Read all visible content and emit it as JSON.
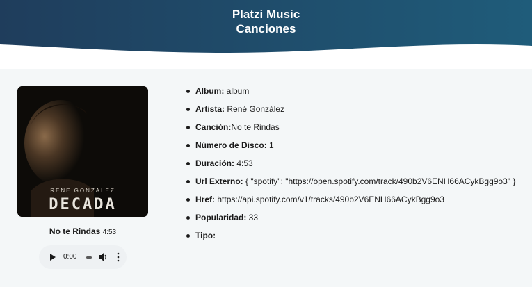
{
  "header": {
    "title_line1": "Platzi Music",
    "title_line2": "Canciones",
    "gradient_start": "#1f3d5c",
    "gradient_end": "#1f5c7a"
  },
  "song": {
    "name": "No te Rindas",
    "duration": "4:53",
    "cover_artist_text": "RENE GONZALEZ",
    "cover_album_text": "DECADA"
  },
  "player": {
    "current_time": "0:00",
    "play_icon": "play-icon",
    "volume_icon": "volume-icon",
    "menu_icon": "more-vert-icon"
  },
  "details": [
    {
      "label": "Album:",
      "value": " album"
    },
    {
      "label": "Artista:",
      "value": " René González"
    },
    {
      "label": "Canción:",
      "value": "No te Rindas"
    },
    {
      "label": "Número de Disco:",
      "value": " 1"
    },
    {
      "label": "Duración:",
      "value": " 4:53"
    },
    {
      "label": "Url Externo:",
      "value": " { \"spotify\": \"https://open.spotify.com/track/490b2V6ENH66ACykBgg9o3\" }"
    },
    {
      "label": "Href:",
      "value": " https://api.spotify.com/v1/tracks/490b2V6ENH66ACykBgg9o3"
    },
    {
      "label": "Popularidad:",
      "value": " 33"
    },
    {
      "label": "Tipo:",
      "value": ""
    }
  ]
}
